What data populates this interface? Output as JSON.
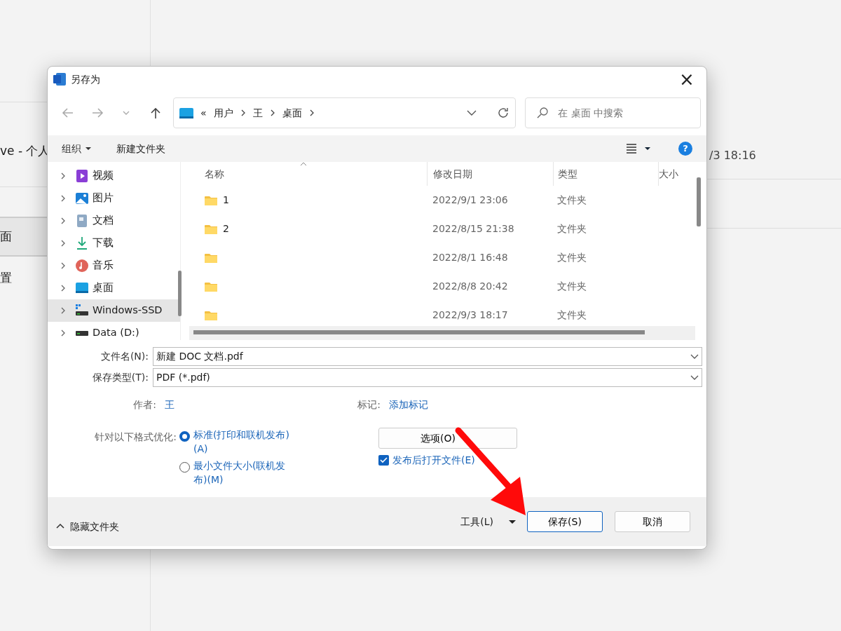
{
  "background": {
    "account_text": "ve - 个人",
    "selected_item": "面",
    "item": "置",
    "time": "/3 18:16"
  },
  "dialog": {
    "title": "另存为",
    "close": "×",
    "help": "?",
    "address": {
      "overflow": "«",
      "crumbs": [
        "用户",
        "王",
        "桌面"
      ]
    },
    "search": {
      "placeholder": "在 桌面 中搜索"
    },
    "toolbar": {
      "organize": "组织",
      "new_folder": "新建文件夹"
    },
    "nav": [
      {
        "label": "视频",
        "kind": "videos",
        "selected": false
      },
      {
        "label": "图片",
        "kind": "pictures",
        "selected": false
      },
      {
        "label": "文档",
        "kind": "documents",
        "selected": false
      },
      {
        "label": "下载",
        "kind": "downloads",
        "selected": false
      },
      {
        "label": "音乐",
        "kind": "music",
        "selected": false
      },
      {
        "label": "桌面",
        "kind": "desktop",
        "selected": false
      },
      {
        "label": "Windows-SSD",
        "kind": "drive",
        "selected": true
      },
      {
        "label": "Data (D:)",
        "kind": "drive2",
        "selected": false
      }
    ],
    "columns": [
      "名称",
      "修改日期",
      "类型",
      "大小"
    ],
    "rows": [
      {
        "name": "1",
        "modified": "2022/9/1 23:06",
        "type": "文件夹"
      },
      {
        "name": "2",
        "modified": "2022/8/15 21:38",
        "type": "文件夹"
      },
      {
        "modified": "2022/8/1 16:48",
        "type": "文件夹"
      },
      {
        "modified": "2022/8/8 20:42",
        "type": "文件夹"
      },
      {
        "modified": "2022/9/3 18:17",
        "type": "文件夹"
      }
    ],
    "file_name": {
      "label": "文件名(N):",
      "value": "新建 DOC 文档.pdf"
    },
    "save_type": {
      "label": "保存类型(T):",
      "value": "PDF (*.pdf)"
    },
    "author": {
      "label": "作者:",
      "value": "王"
    },
    "tags": {
      "label": "标记:",
      "value": "添加标记"
    },
    "optimize": {
      "label": "针对以下格式优化:",
      "options": [
        {
          "label": "标准(打印和联机发布)(A)",
          "selected": true
        },
        {
          "label": "最小文件大小(联机发布)(M)",
          "selected": false
        }
      ]
    },
    "options_button": "选项(O)",
    "open_after": {
      "label": "发布后打开文件(E)",
      "checked": true
    },
    "hide_folders": "隐藏文件夹",
    "tools": "工具(L)",
    "save": "保存(S)",
    "cancel": "取消"
  }
}
